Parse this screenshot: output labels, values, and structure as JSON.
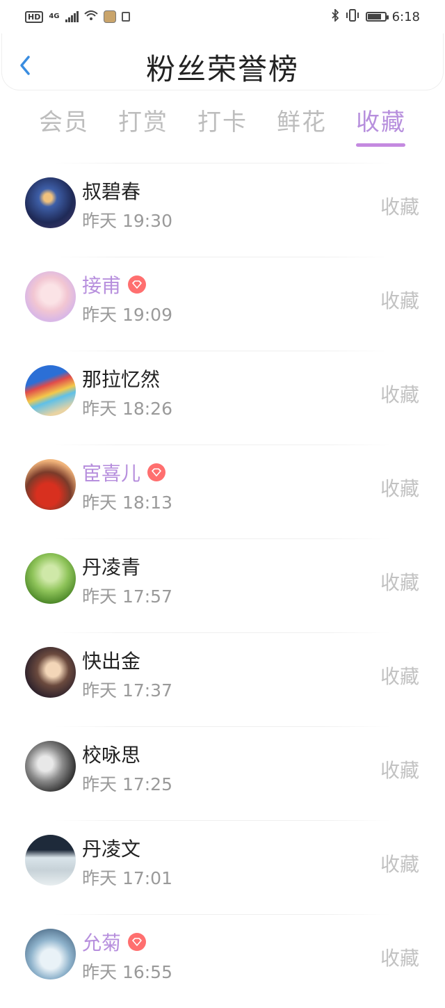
{
  "status_bar": {
    "left": {
      "hd": "HD",
      "network": "4G"
    },
    "time": "6:18"
  },
  "header": {
    "title": "粉丝荣誉榜"
  },
  "tabs": [
    {
      "label": "会员",
      "active": false
    },
    {
      "label": "打赏",
      "active": false
    },
    {
      "label": "打卡",
      "active": false
    },
    {
      "label": "鲜花",
      "active": false
    },
    {
      "label": "收藏",
      "active": true
    }
  ],
  "colors": {
    "accent": "#b78fdd",
    "badge": "#ff6f6f",
    "muted": "#9a9a9a"
  },
  "fans": [
    {
      "name": "叔碧春",
      "time": "昨天 19:30",
      "action": "收藏",
      "vip": false,
      "avatar_icon": "anime-warrior-avatar"
    },
    {
      "name": "接甫",
      "time": "昨天 19:09",
      "action": "收藏",
      "vip": true,
      "avatar_icon": "anime-girl-avatar"
    },
    {
      "name": "那拉忆然",
      "time": "昨天 18:26",
      "action": "收藏",
      "vip": false,
      "avatar_icon": "beach-umbrella-avatar"
    },
    {
      "name": "宦喜儿",
      "time": "昨天 18:13",
      "action": "收藏",
      "vip": true,
      "avatar_icon": "red-flowers-avatar"
    },
    {
      "name": "丹凌青",
      "time": "昨天 17:57",
      "action": "收藏",
      "vip": false,
      "avatar_icon": "grass-avatar"
    },
    {
      "name": "快出金",
      "time": "昨天 17:37",
      "action": "收藏",
      "vip": false,
      "avatar_icon": "couple-photo-avatar"
    },
    {
      "name": "校咏思",
      "time": "昨天 17:25",
      "action": "收藏",
      "vip": false,
      "avatar_icon": "monochrome-portrait-avatar"
    },
    {
      "name": "丹凌文",
      "time": "昨天 17:01",
      "action": "收藏",
      "vip": false,
      "avatar_icon": "久别-poster-avatar"
    },
    {
      "name": "允菊",
      "time": "昨天 16:55",
      "action": "收藏",
      "vip": true,
      "avatar_icon": "blue-anime-avatar"
    }
  ]
}
